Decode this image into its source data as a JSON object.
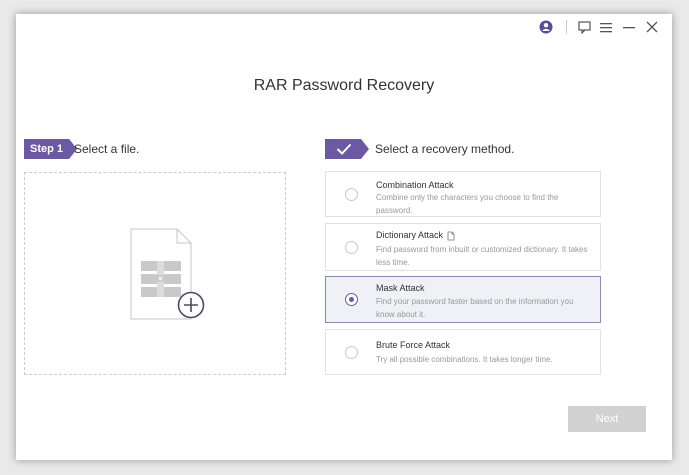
{
  "app": {
    "title": "RAR Password Recovery"
  },
  "titlebar": {
    "icons": [
      "account-icon",
      "feedback-icon",
      "menu-icon",
      "minimize-icon",
      "close-icon"
    ]
  },
  "step1": {
    "badge": "Step 1",
    "text": "Select a file."
  },
  "step2": {
    "text": "Select a recovery method."
  },
  "methods": [
    {
      "title": "Combination Attack",
      "desc": "Combine only the characters you choose to find the password.",
      "selected": false
    },
    {
      "title": "Dictionary Attack",
      "desc": "Find password from inbuilt or customized dictionary. It takes less time.",
      "selected": false
    },
    {
      "title": "Mask Attack",
      "desc": "Find your password faster based on the information you know about it.",
      "selected": true
    },
    {
      "title": "Brute Force Attack",
      "desc": "Try all possible combinations. It takes longer time.",
      "selected": false
    }
  ],
  "next_label": "Next",
  "colors": {
    "accent": "#6b5aa3",
    "selected_bg": "#f0f0f7",
    "disabled_button": "#d2d2d2"
  }
}
